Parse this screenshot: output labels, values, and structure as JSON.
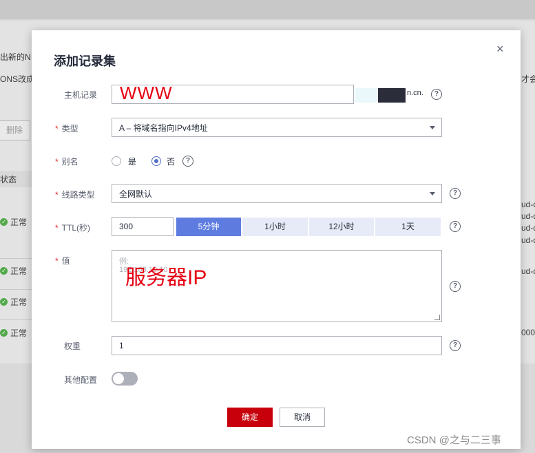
{
  "background": {
    "line1": "出新的N",
    "line2": "ONS改成",
    "line2_right": "才会",
    "delete_button": "删除",
    "status_header": "状态",
    "rows": [
      {
        "status": "正常"
      },
      {
        "status": "正常"
      },
      {
        "status": "正常"
      },
      {
        "status": "正常"
      }
    ],
    "right_texts": [
      "ud-d",
      "ud-d",
      "ud-d",
      "ud-d",
      "ud-d",
      "000"
    ]
  },
  "dialog": {
    "title": "添加记录集",
    "close": "×",
    "host_record": {
      "label": "主机记录",
      "value": "WWW",
      "suffix": "n.cn."
    },
    "type": {
      "label": "类型",
      "value": "A – 将域名指向IPv4地址"
    },
    "alias": {
      "label": "别名",
      "options": [
        "是",
        "否"
      ],
      "selected": "否"
    },
    "line_type": {
      "label": "线路类型",
      "value": "全网默认"
    },
    "ttl": {
      "label": "TTL(秒)",
      "value": "300",
      "presets": [
        "5分钟",
        "1小时",
        "12小时",
        "1天"
      ],
      "active_preset": "5分钟"
    },
    "value_field": {
      "label": "值",
      "placeholder_line1": "例:",
      "placeholder_line2": "192.168.10.10",
      "annotation": "服务器IP"
    },
    "weight": {
      "label": "权重",
      "value": "1"
    },
    "other_config": {
      "label": "其他配置",
      "enabled": false
    },
    "confirm_button": "确定",
    "cancel_button": "取消",
    "help_glyph": "?"
  },
  "watermark": "CSDN @之与二三事",
  "colors": {
    "primary": "#5e7ce0",
    "confirm": "#c7000b",
    "required": "#e02d2d",
    "annotation": "#e60012"
  }
}
